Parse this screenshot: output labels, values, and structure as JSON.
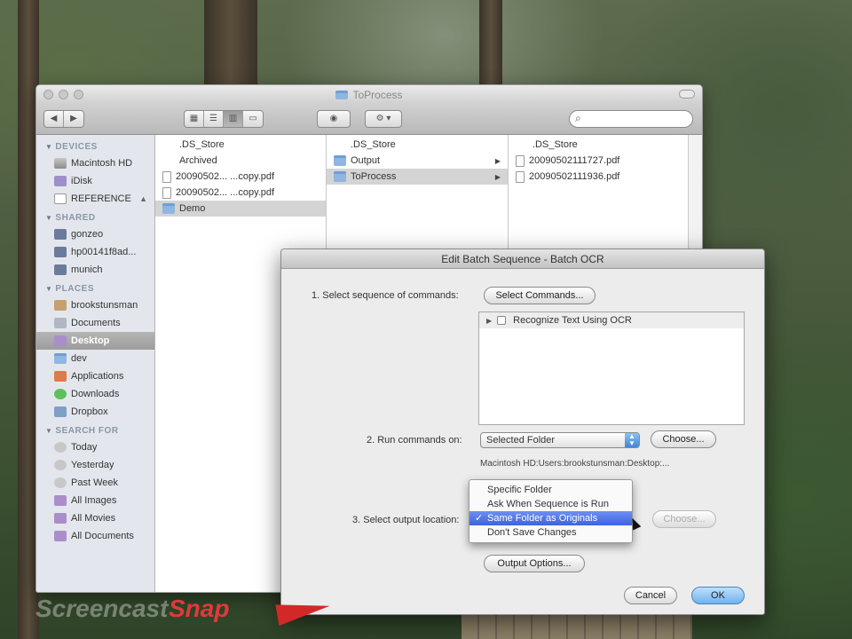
{
  "finder": {
    "title": "ToProcess",
    "sidebar": {
      "devices_header": "DEVICES",
      "devices": [
        {
          "label": "Macintosh HD",
          "icon": "hard-drive-icon"
        },
        {
          "label": "iDisk",
          "icon": "idisk-icon"
        },
        {
          "label": "REFERENCE",
          "icon": "disk-icon",
          "eject": "▲"
        }
      ],
      "shared_header": "SHARED",
      "shared": [
        {
          "label": "gonzeo",
          "icon": "computer-icon"
        },
        {
          "label": "hp00141f8ad...",
          "icon": "computer-icon"
        },
        {
          "label": "munich",
          "icon": "computer-icon"
        }
      ],
      "places_header": "PLACES",
      "places": [
        {
          "label": "brookstunsman",
          "icon": "home-icon"
        },
        {
          "label": "Documents",
          "icon": "documents-icon"
        },
        {
          "label": "Desktop",
          "icon": "desktop-icon",
          "selected": true
        },
        {
          "label": "dev",
          "icon": "dev-icon"
        },
        {
          "label": "Applications",
          "icon": "applications-icon"
        },
        {
          "label": "Downloads",
          "icon": "downloads-icon"
        },
        {
          "label": "Dropbox",
          "icon": "dropbox-icon"
        }
      ],
      "search_header": "SEARCH FOR",
      "search": [
        {
          "label": "Today",
          "icon": "clock-icon"
        },
        {
          "label": "Yesterday",
          "icon": "clock-icon"
        },
        {
          "label": "Past Week",
          "icon": "clock-icon"
        },
        {
          "label": "All Images",
          "icon": "images-icon"
        },
        {
          "label": "All Movies",
          "icon": "movies-icon"
        },
        {
          "label": "All Documents",
          "icon": "documents-icon"
        }
      ]
    },
    "columns": [
      [
        {
          "label": ".DS_Store",
          "type": "blank"
        },
        {
          "label": "Archived",
          "type": "blank"
        },
        {
          "label": "20090502... ...copy.pdf",
          "type": "file"
        },
        {
          "label": "20090502... ...copy.pdf",
          "type": "file"
        },
        {
          "label": "Demo",
          "type": "folder",
          "selected": true
        }
      ],
      [
        {
          "label": ".DS_Store",
          "type": "blank"
        },
        {
          "label": "Output",
          "type": "folder",
          "arrow": "▶"
        },
        {
          "label": "ToProcess",
          "type": "folder",
          "selected": true,
          "arrow": "▶"
        }
      ],
      [
        {
          "label": ".DS_Store",
          "type": "blank"
        },
        {
          "label": "20090502111727.pdf",
          "type": "file"
        },
        {
          "label": "20090502111936.pdf",
          "type": "file"
        }
      ]
    ]
  },
  "dialog": {
    "title": "Edit Batch Sequence - Batch OCR",
    "step1_label": "1. Select sequence of commands:",
    "select_commands_button": "Select Commands...",
    "commands": [
      {
        "label": "Recognize Text Using OCR"
      }
    ],
    "step2_label": "2. Run commands on:",
    "run_on_value": "Selected Folder",
    "choose_button": "Choose...",
    "folder_path": "Macintosh HD:Users:brookstunsman:Desktop:...",
    "step3_label": "3. Select output location:",
    "choose_button_disabled": "Choose...",
    "output_options_button": "Output Options...",
    "cancel_button": "Cancel",
    "ok_button": "OK",
    "output_menu": {
      "items": [
        {
          "label": "Specific Folder"
        },
        {
          "label": "Ask When Sequence is Run"
        },
        {
          "label": "Same Folder as Originals",
          "checked": true
        },
        {
          "label": "Don't Save Changes"
        }
      ],
      "check_mark": "✓"
    }
  },
  "watermark": {
    "text": "Screencast",
    "snap": "Snap"
  }
}
